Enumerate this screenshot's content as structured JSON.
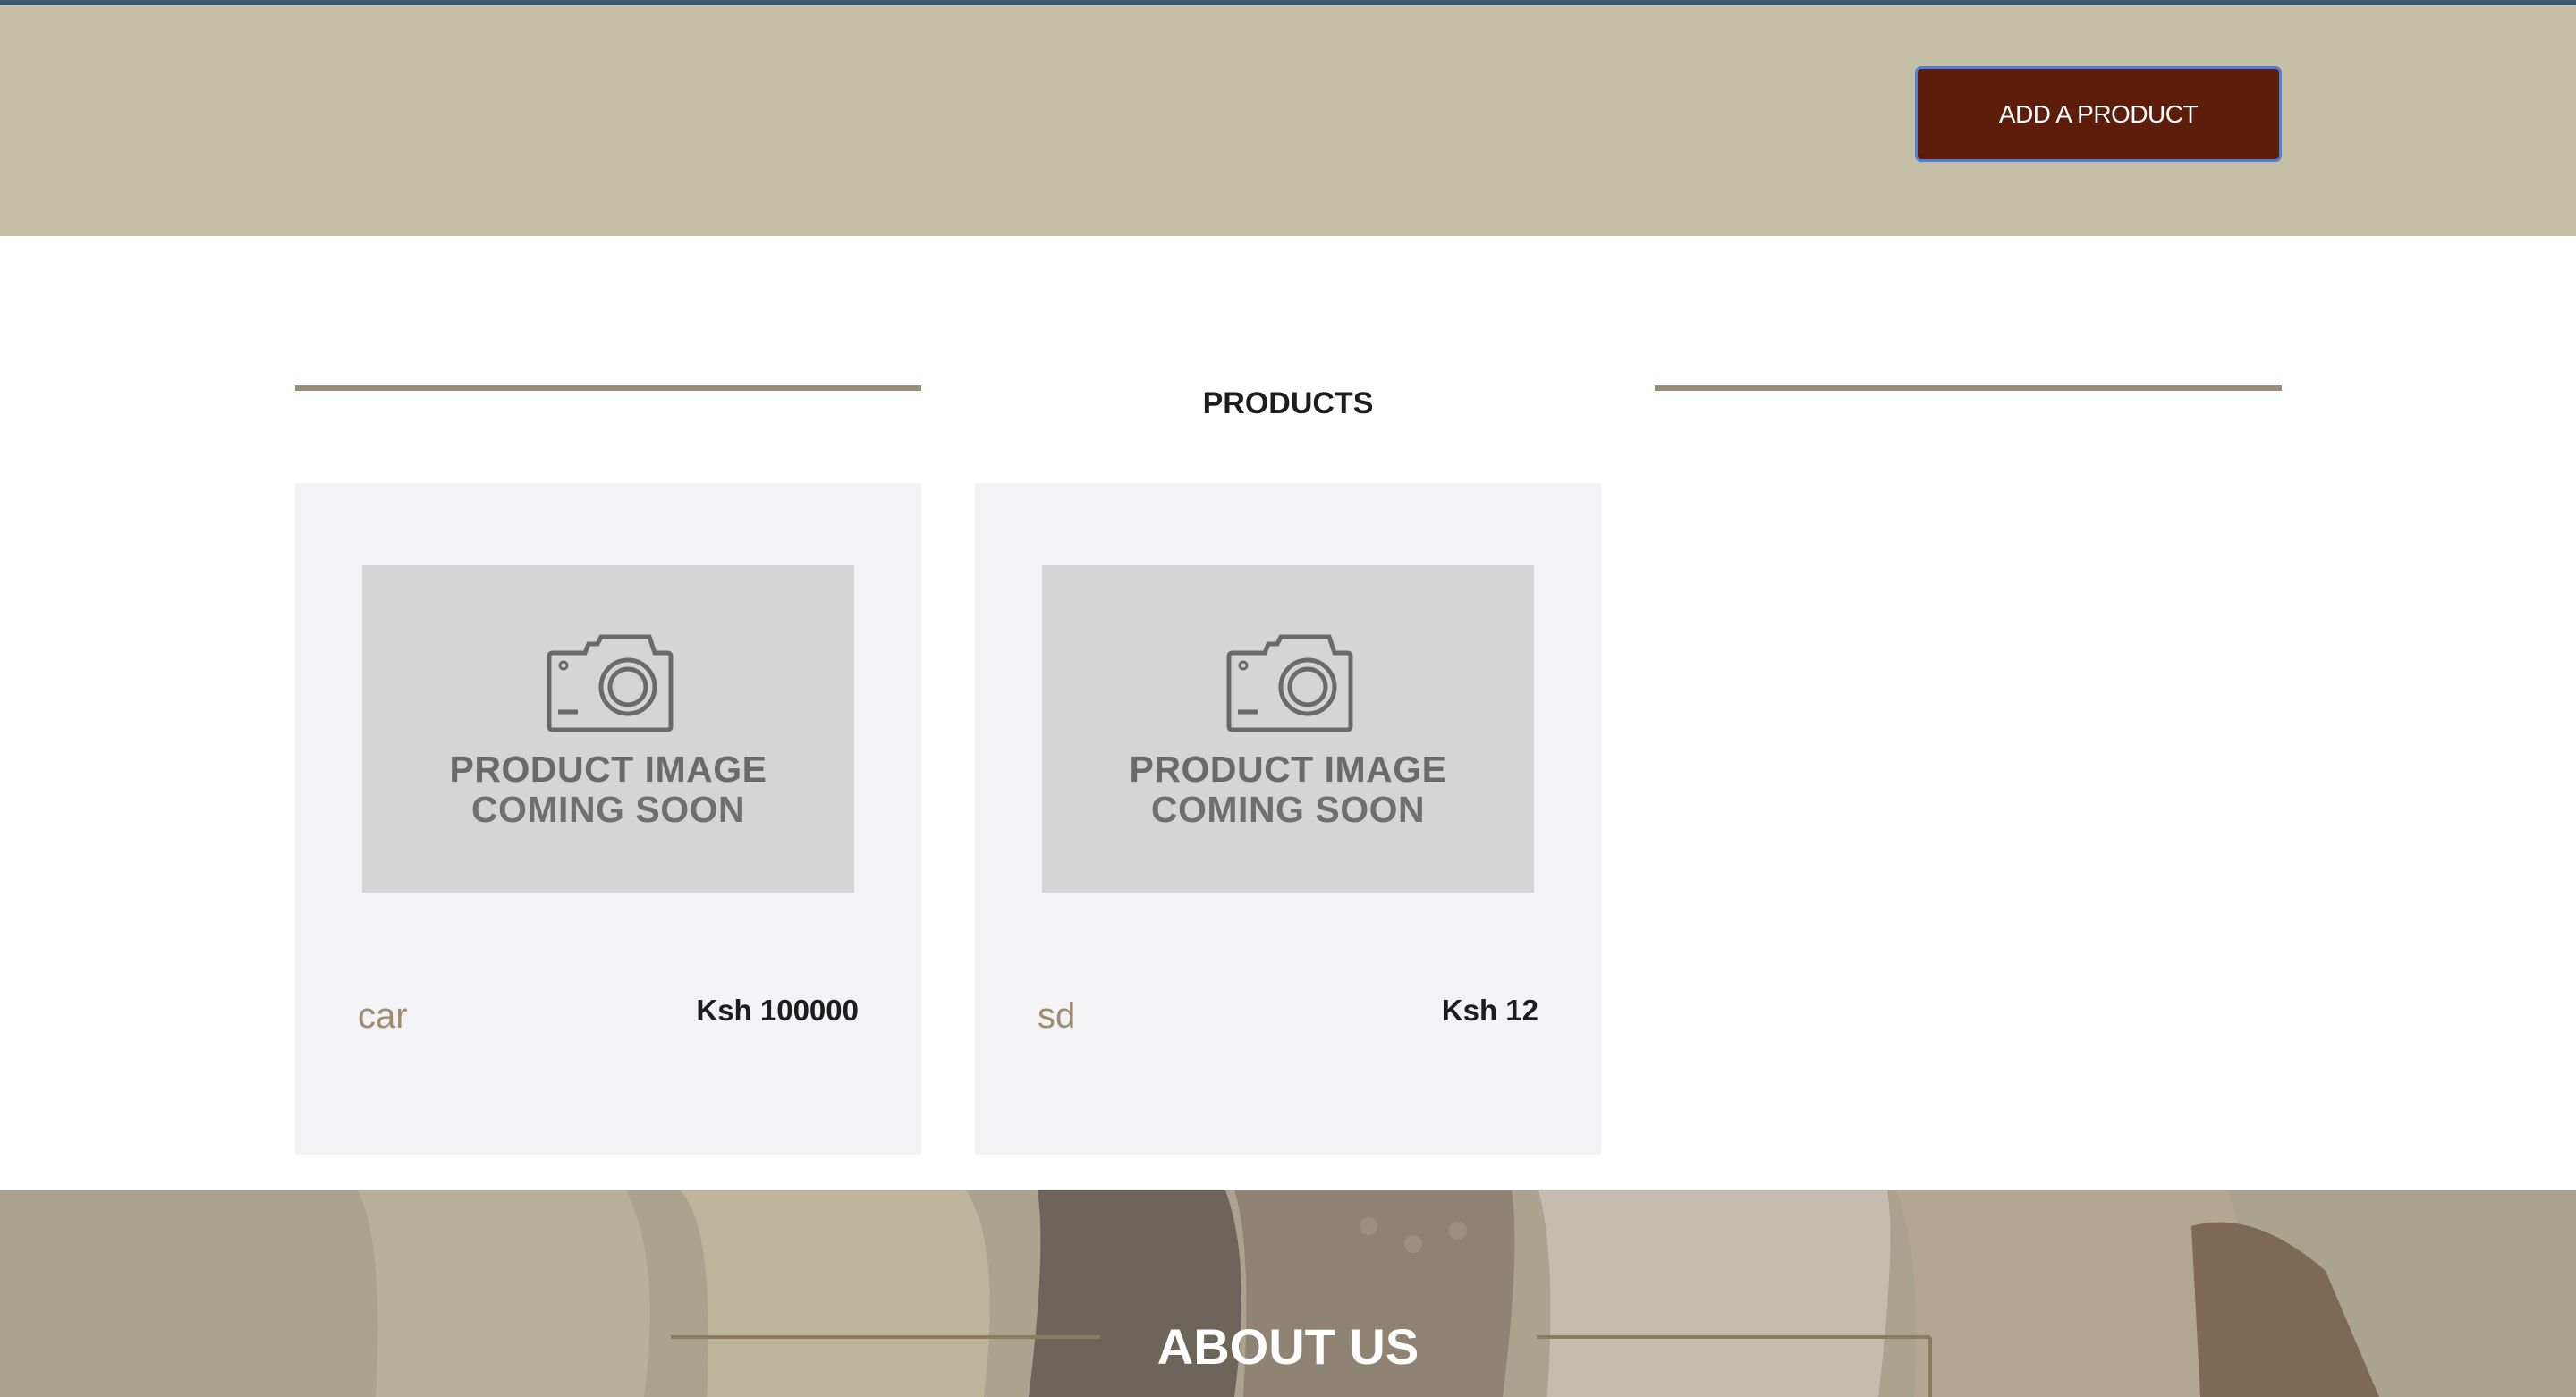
{
  "header": {
    "add_product_label": "ADD A PRODUCT",
    "background_color": "#c5bfa8",
    "button_color": "#5e1d0b"
  },
  "products_section": {
    "title": "PRODUCTS",
    "divider_color": "#9b8c75"
  },
  "products": [
    {
      "name": "car",
      "price": "Ksh 100000",
      "image_placeholder": {
        "line1": "PRODUCT IMAGE",
        "line2": "COMING SOON",
        "icon": "camera-icon"
      }
    },
    {
      "name": "sd",
      "price": "Ksh 12",
      "image_placeholder": {
        "line1": "PRODUCT IMAGE",
        "line2": "COMING SOON",
        "icon": "camera-icon"
      }
    }
  ],
  "about_section": {
    "title": "ABOUT US"
  }
}
